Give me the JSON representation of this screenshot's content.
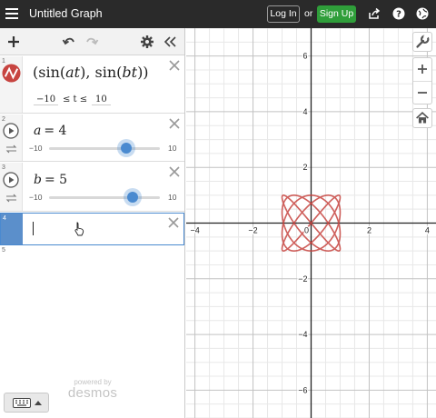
{
  "app": {
    "title": "Untitled Graph",
    "login_label": "Log In",
    "or_text": "or",
    "signup_label": "Sign Up",
    "icons": [
      "hamburger-menu-icon",
      "share-icon",
      "help-icon",
      "globe-icon"
    ]
  },
  "toolbar": {
    "icons": [
      "add-icon",
      "undo-icon",
      "redo-icon",
      "gear-icon",
      "collapse-icon"
    ]
  },
  "expressions": [
    {
      "number": "1",
      "expr_parts": [
        "(sin(",
        "at",
        "), sin(",
        "bt",
        "))"
      ],
      "t_min": "−10",
      "t_op": "≤ t ≤",
      "t_max": "10",
      "color": "#c74440"
    },
    {
      "number": "2",
      "var": "a",
      "eq": "= 4",
      "value": 4,
      "slider_min": "−10",
      "slider_max": "10"
    },
    {
      "number": "3",
      "var": "b",
      "eq": "= 5",
      "value": 5,
      "slider_min": "−10",
      "slider_max": "10"
    },
    {
      "number": "4"
    },
    {
      "number": "5"
    }
  ],
  "footer": {
    "powered_by": "powered by",
    "brand": "desmos"
  },
  "graph": {
    "x_ticks": [
      "−4",
      "−2",
      "0",
      "2",
      "4"
    ],
    "y_ticks": [
      "6",
      "4",
      "2",
      "−2",
      "−4",
      "−6"
    ],
    "x_range": [
      -4.3,
      4.3
    ],
    "y_range": [
      -7,
      7
    ],
    "curve_color": "#c74440",
    "side_icons": [
      "wrench-icon",
      "zoom-in-icon",
      "zoom-out-icon",
      "home-icon"
    ]
  }
}
